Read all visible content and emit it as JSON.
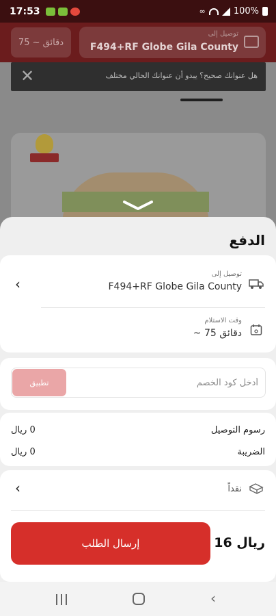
{
  "status_bar": {
    "time": "17:53",
    "battery": "100%"
  },
  "background": {
    "time_chip": "75 ~ دقائق",
    "address_chip": {
      "label": "توصيل إلى",
      "value": "F494+RF Globe Gila County"
    },
    "toast": {
      "message": "هل عنوانك صحيح؟ يبدو أن عنوانك الحالي مختلف"
    }
  },
  "sheet": {
    "title": "الدفع",
    "delivery": {
      "label": "توصيل إلى",
      "value": "F494+RF Globe Gila County"
    },
    "pickup_time": {
      "label": "وقت الاستلام",
      "value": "~ 75 دقائق"
    },
    "discount": {
      "placeholder": "أدخل كود الخصم",
      "apply_label": "تطبيق"
    },
    "fees": {
      "delivery_label": "رسوم التوصيل",
      "delivery_value": "0 ريال",
      "tax_label": "الضريبة",
      "tax_value": "0 ريال"
    },
    "payment": {
      "method": "نقداً"
    },
    "total": "16 ريال",
    "submit_label": "إرسال الطلب"
  }
}
